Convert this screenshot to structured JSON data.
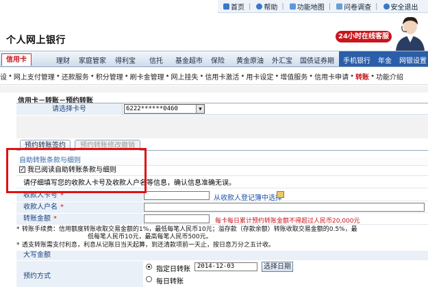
{
  "top_links": [
    {
      "label": "首页",
      "icon": "home-icon",
      "color": "#3a78c8"
    },
    {
      "label": "帮助",
      "icon": "help-icon",
      "color": "#3a78c8"
    },
    {
      "label": "功能地图",
      "icon": "map-icon",
      "color": "#3a78c8"
    },
    {
      "label": "问卷调查",
      "icon": "survey-icon",
      "color": "#3a78c8"
    },
    {
      "label": "安全退出",
      "icon": "logout-icon",
      "color": "#3a78c8"
    }
  ],
  "brand": "个人网上银行",
  "hotline_badge": "24小时在线客服",
  "nav": {
    "active_tab": "信用卡",
    "items": [
      "理财",
      "家庭管家",
      "得利宝",
      "信托",
      "基金超市",
      "保险",
      "黄金原油",
      "外汇宝",
      "国债证券期"
    ],
    "right_items": [
      "手机银行",
      "年金",
      "网银设置"
    ]
  },
  "subnav": {
    "items": [
      "设",
      "网上支付管理",
      "还款服务",
      "积分管理",
      "刷卡金管理",
      "网上挂失",
      "信用卡激活",
      "用卡设定",
      "增值服务",
      "信用卡申请",
      "转账",
      "功能介绍"
    ],
    "active": "转账"
  },
  "page_title": "信用卡－转账－预约转账",
  "card_select": {
    "label": "请选择卡号",
    "value": "6222******0460"
  },
  "tabs": [
    {
      "label": "预约转账签约",
      "active": true
    },
    {
      "label": "预约转账修改撤销",
      "active": false
    }
  ],
  "agreement": {
    "title": "自助转账条款与细则",
    "checkbox_label": "我已阅读自助转账条款与细则",
    "checked": true
  },
  "notice": "请仔细填写您的收款人卡号及收款人户名等信息，确认信息准确无误。",
  "fields": {
    "payee_card_label": "收款人卡号",
    "payee_name_label": "收款人户名",
    "amount_label": "转账金额",
    "required_mark": "*",
    "select_from_list": "从收款人登记簿中选择",
    "amount_limit_note": "每卡每日累计预约转账金额不得超过人民币20,000元"
  },
  "fee_notes": {
    "line1": "转账手续费：信用额度转账收取交易金额的1%，最低每笔人民币10元；溢存款（存款余额）转账收取交易金额的0.5%，最",
    "line2": "低每笔人民币10元，最高每笔人民币500元。",
    "line3": "透支转账需支付利息，利息从记账日当天起算，到还清款项前一天止，按日息万分之五计收。",
    "star": "*"
  },
  "big_amount_label": "大写金额",
  "schedule": {
    "label": "预约方式",
    "option1": "指定日转账",
    "option2": "每日转账",
    "date_value": "2014-12-03",
    "date_button": "选择日期",
    "selected": "指定日转账"
  },
  "colors": {
    "highlight_box": "#e01010",
    "brand_red": "#c8161d",
    "nav_blue": "#2b5ea8"
  }
}
